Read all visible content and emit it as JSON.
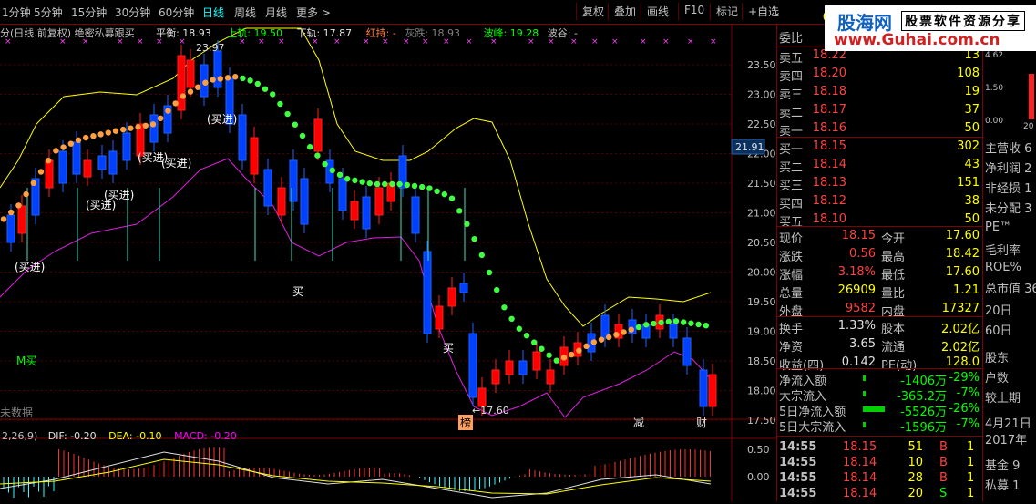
{
  "toolbar": {
    "periods": [
      "1分钟",
      "5分钟",
      "15分钟",
      "30分钟",
      "60分钟",
      "日线",
      "周线",
      "月线",
      "更多 >"
    ],
    "active_period": "日线",
    "buttons": [
      "复权",
      "叠加",
      "画线",
      "F10",
      "标记",
      "+自选"
    ]
  },
  "legend": {
    "title": "分(日线 前复权) 绝密私募跟买",
    "pingheng": "平衡: 18.93",
    "shanggui": "上轨: 19.50",
    "xiagui": "下轨: 17.87",
    "hongchi": "红持: -",
    "huidie": "灰跌: 18.93",
    "bofeng": "波峰: 19.28",
    "bogu": "波谷: -"
  },
  "price_axis": [
    "23.50",
    "23.00",
    "22.50",
    "22.00",
    "21.50",
    "21.00",
    "20.50",
    "20.00",
    "19.50",
    "19.00",
    "18.50",
    "18.00",
    "17.50"
  ],
  "current_price_tag": "21.91",
  "chart_labels": {
    "peak": "23.97",
    "buy_marks": [
      "(买进)",
      "(买进)",
      "(买进)",
      "(买进)",
      "(买进)",
      "(买进)"
    ],
    "mai1": "买",
    "mai2": "买",
    "low_mark": "←17.60",
    "m_buy": "M买",
    "bang": "榜",
    "jian": "减",
    "cai": "财",
    "data_note": "未数据"
  },
  "macd_legend": {
    "params": "2,26,9)",
    "dif": "DIF: -0.20",
    "dea": "DEA: -0.10",
    "macd": "MACD: -0.20"
  },
  "macd_axis": [
    "0.50",
    "0.00"
  ],
  "panel": {
    "weibi_label": "委比",
    "asks": [
      {
        "label": "卖五",
        "price": "18.22",
        "vol": "13"
      },
      {
        "label": "卖四",
        "price": "18.20",
        "vol": "108"
      },
      {
        "label": "卖三",
        "price": "18.18",
        "vol": "19"
      },
      {
        "label": "卖二",
        "price": "18.17",
        "vol": "37"
      },
      {
        "label": "卖一",
        "price": "18.16",
        "vol": "50"
      }
    ],
    "bids": [
      {
        "label": "买一",
        "price": "18.15",
        "vol": "302"
      },
      {
        "label": "买二",
        "price": "18.14",
        "vol": "43"
      },
      {
        "label": "买三",
        "price": "18.13",
        "vol": "151"
      },
      {
        "label": "买四",
        "price": "18.12",
        "vol": "38"
      },
      {
        "label": "买五",
        "price": "18.10",
        "vol": "50"
      }
    ],
    "quote": [
      {
        "l1": "现价",
        "v1": "18.15",
        "l2": "今开",
        "v2": "17.60"
      },
      {
        "l1": "涨跌",
        "v1": "0.56",
        "l2": "最高",
        "v2": "18.42"
      },
      {
        "l1": "涨幅",
        "v1": "3.18%",
        "l2": "最低",
        "v2": "17.60"
      },
      {
        "l1": "总量",
        "v1": "26909",
        "l2": "量比",
        "v2": "1.21"
      },
      {
        "l1": "外盘",
        "v1": "9582",
        "l2": "内盘",
        "v2": "17327"
      }
    ],
    "info": [
      {
        "l1": "换手",
        "v1": "1.33%",
        "l2": "股本",
        "v2": "2.02亿"
      },
      {
        "l1": "净资",
        "v1": "3.65",
        "l2": "流通",
        "v2": "2.02亿"
      },
      {
        "l1": "收益(四)",
        "v1": "0.142",
        "l2": "PE(动)",
        "v2": "128.0"
      }
    ],
    "flows": [
      {
        "label": "净流入额",
        "val": "-1406万",
        "pct": "-29%"
      },
      {
        "label": "大宗流入",
        "val": "-365.2万",
        "pct": "-7%"
      },
      {
        "label": "5日净流入额",
        "val": "-5526万",
        "pct": "-26%"
      },
      {
        "label": "5日大宗流入",
        "val": "-1596万",
        "pct": "-7%"
      }
    ],
    "ticks": [
      {
        "time": "14:55",
        "price": "18.15",
        "vol": "51",
        "side": "B",
        "n": "1"
      },
      {
        "time": "14:55",
        "price": "18.14",
        "vol": "10",
        "side": "B",
        "n": "1"
      },
      {
        "time": "14:55",
        "price": "18.14",
        "vol": "28",
        "side": "B",
        "n": "1"
      },
      {
        "time": "14:55",
        "price": "18.14",
        "vol": "20",
        "side": "S",
        "n": "1"
      }
    ]
  },
  "far_panel": {
    "top_value": "0",
    "mini_axis": [
      "4.62",
      "1.50",
      "0.00"
    ],
    "mini_tick": "20",
    "items": [
      "主营收 6",
      "净利润 2",
      "非经损 1",
      "未分配 3",
      "PE™",
      "毛利率",
      "ROE%",
      "总市值 36",
      "20日",
      "60日",
      "股东",
      "户数",
      "较上期",
      "4月21日",
      "2017年",
      "基金 9",
      "私募 1"
    ]
  },
  "logo": {
    "brand": "股海网",
    "url": "www.Guhai.com.cn",
    "slogan": "股票软件资源分享"
  }
}
